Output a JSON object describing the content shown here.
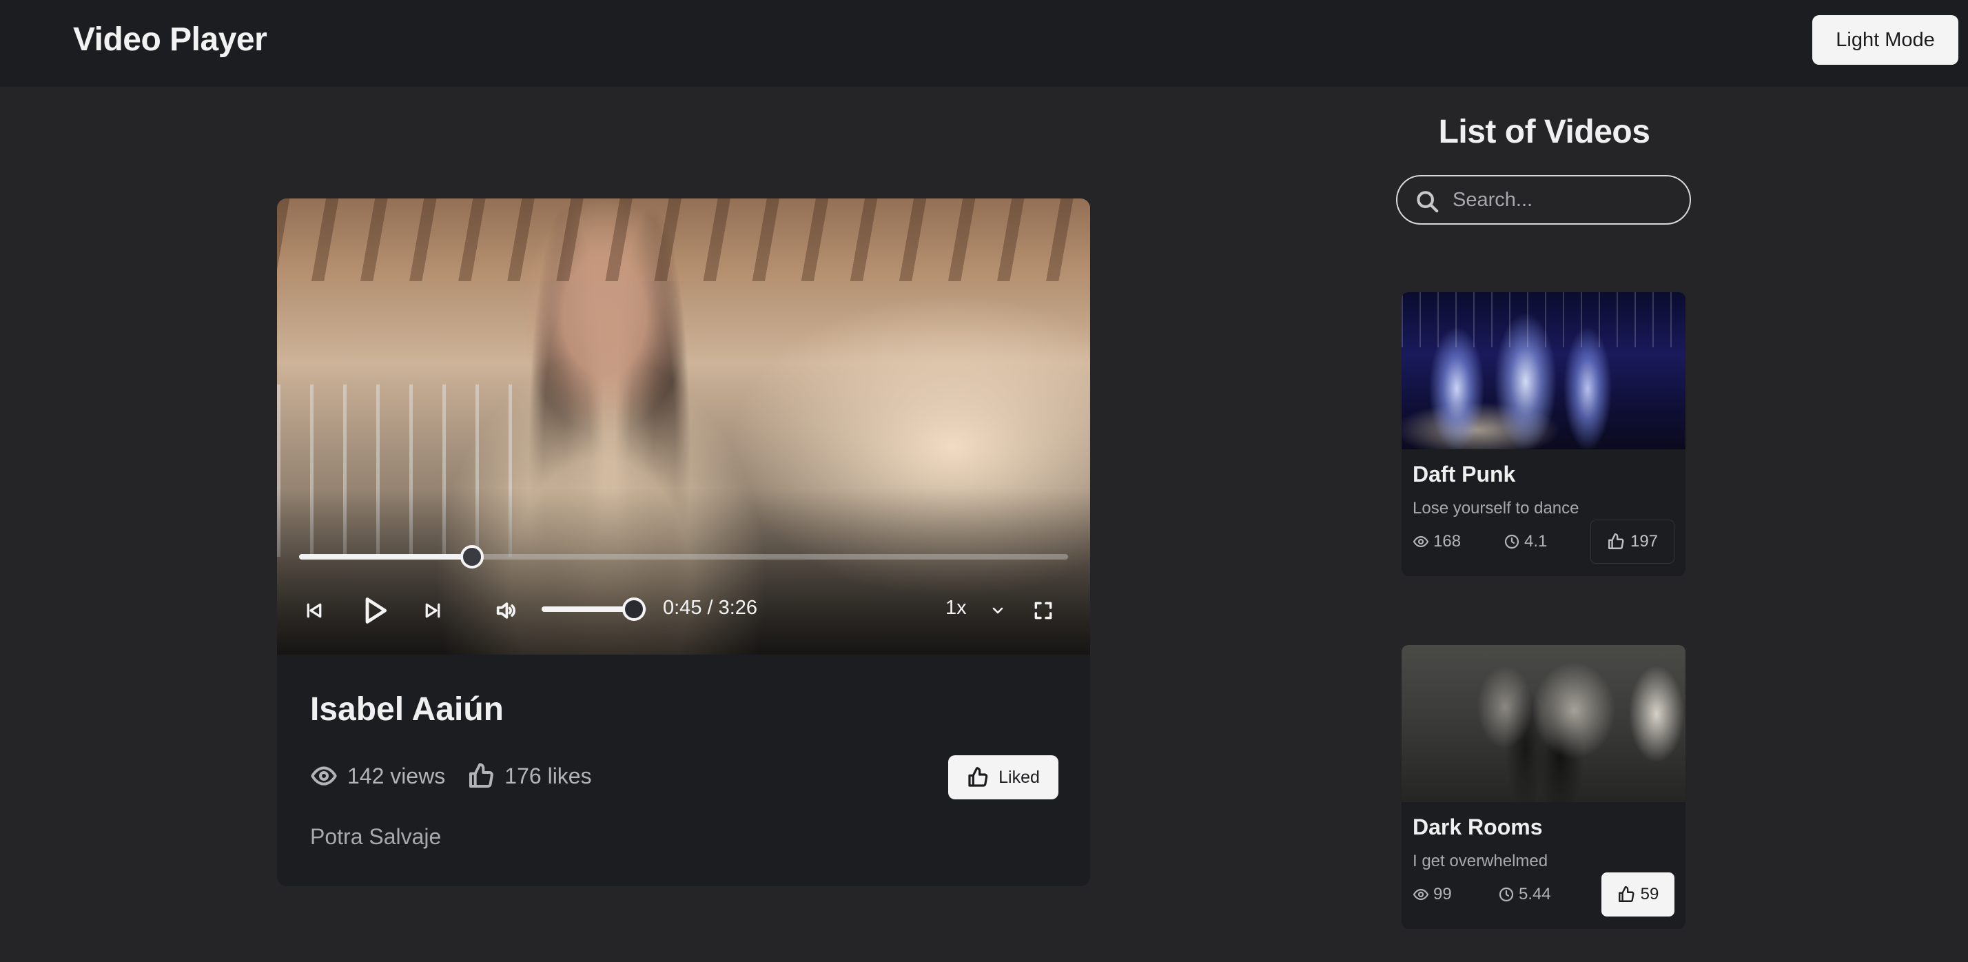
{
  "header": {
    "title": "Video Player",
    "theme_toggle_label": "Light Mode"
  },
  "player": {
    "current_time": "0:45",
    "duration": "3:26",
    "time_display": "0:45 / 3:26",
    "progress_fraction": 0.225,
    "volume_fraction": 0.88,
    "playback_speed": "1x",
    "icons": [
      "skip-back-icon",
      "play-icon",
      "skip-forward-icon",
      "volume-icon",
      "chevron-down-icon",
      "fullscreen-icon"
    ]
  },
  "video": {
    "title": "Isabel Aaiún",
    "views": "142 views",
    "likes": "176 likes",
    "liked_label": "Liked",
    "channel": "Potra Salvaje"
  },
  "sidebar": {
    "title": "List of Videos",
    "search_placeholder": "Search...",
    "videos": [
      {
        "title": "Daft Punk",
        "description": "Lose yourself to dance",
        "views": "168",
        "duration": "4.1",
        "likes": "197",
        "liked": false
      },
      {
        "title": "Dark Rooms",
        "description": "I get overwhelmed",
        "views": "99",
        "duration": "5.44",
        "likes": "59",
        "liked": true
      }
    ]
  },
  "colors": {
    "background": "#252528",
    "surface": "#1c1d21",
    "button_light": "#f4f4f4",
    "text_muted": "#b4b4b8"
  }
}
